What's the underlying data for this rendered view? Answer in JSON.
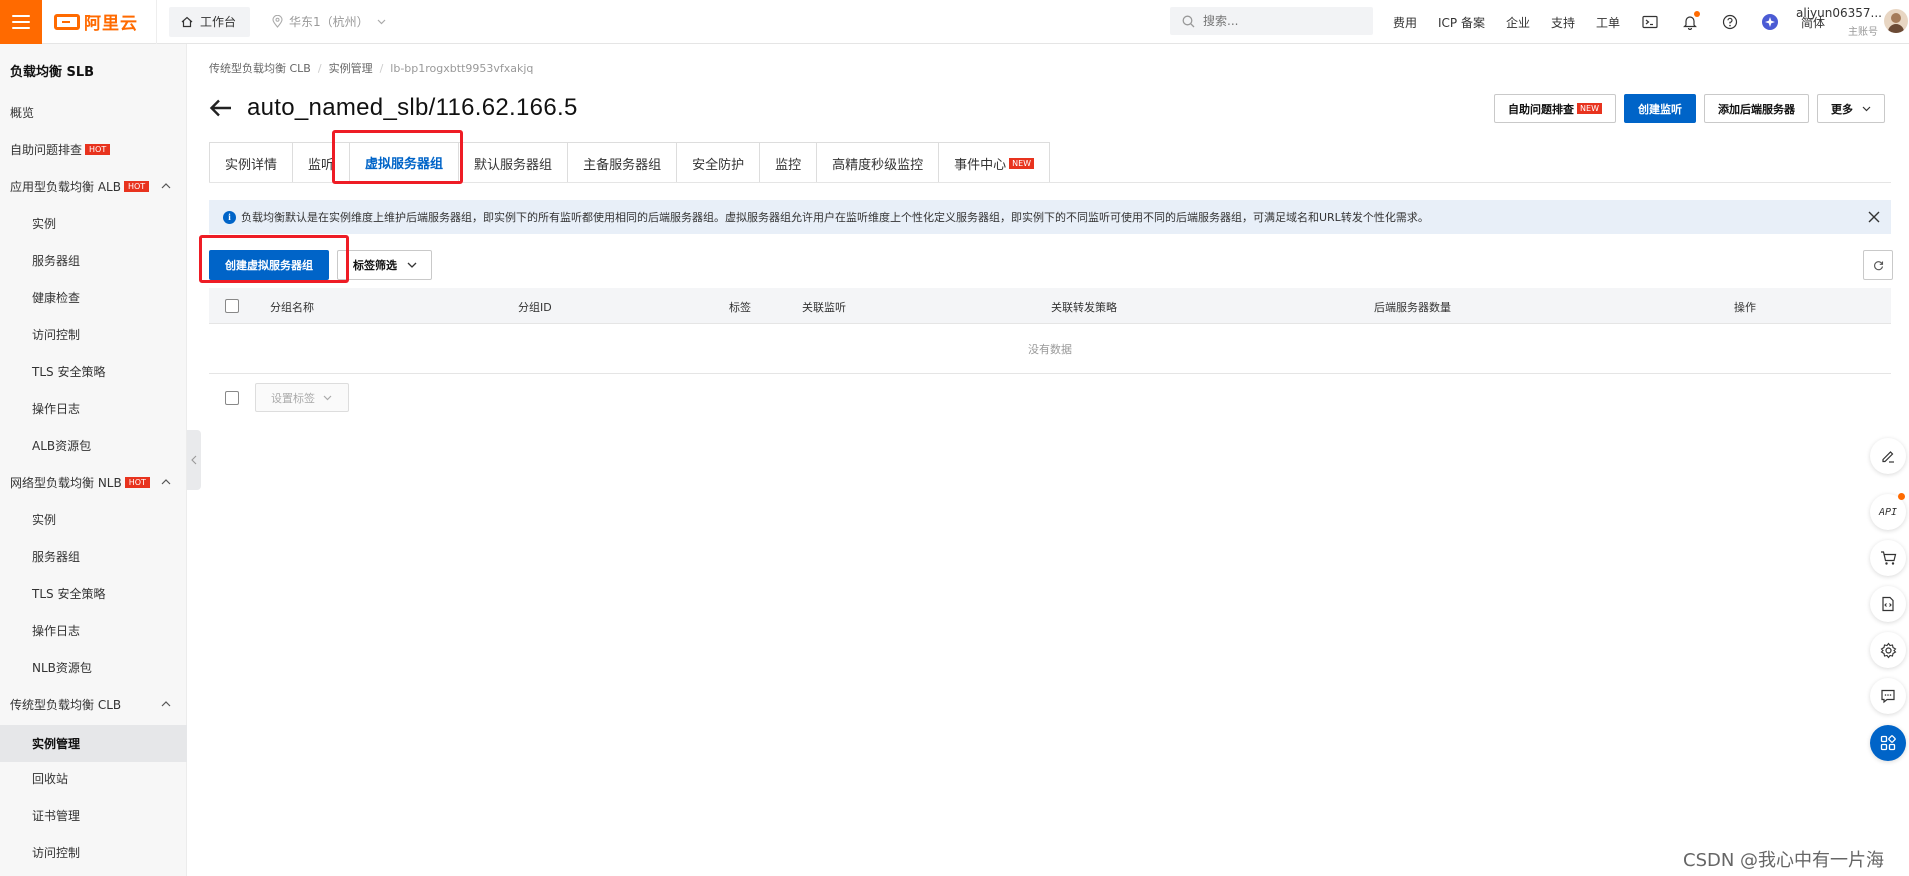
{
  "topbar": {
    "logo_text": "阿里云",
    "workbench_label": "工作台",
    "region_label": "华东1（杭州）",
    "search_placeholder": "搜索...",
    "links": [
      "费用",
      "ICP 备案",
      "企业",
      "支持",
      "工单"
    ],
    "lang_label": "简体",
    "user_name": "aliyun06357...",
    "user_role": "主账号",
    "brand_color": "#ff6a00"
  },
  "sidebar": {
    "title": "负载均衡 SLB",
    "items": [
      {
        "label": "概览",
        "level": 1
      },
      {
        "label": "自助问题排查",
        "level": 1,
        "badge": "HOT"
      },
      {
        "label": "应用型负载均衡 ALB",
        "level": 1,
        "badge": "HOT",
        "expanded": true
      },
      {
        "label": "实例",
        "level": 2
      },
      {
        "label": "服务器组",
        "level": 2
      },
      {
        "label": "健康检查",
        "level": 2
      },
      {
        "label": "访问控制",
        "level": 2
      },
      {
        "label": "TLS 安全策略",
        "level": 2
      },
      {
        "label": "操作日志",
        "level": 2
      },
      {
        "label": "ALB资源包",
        "level": 2
      },
      {
        "label": "网络型负载均衡 NLB",
        "level": 1,
        "badge": "HOT",
        "expanded": true
      },
      {
        "label": "实例",
        "level": 2
      },
      {
        "label": "服务器组",
        "level": 2
      },
      {
        "label": "TLS 安全策略",
        "level": 2
      },
      {
        "label": "操作日志",
        "level": 2
      },
      {
        "label": "NLB资源包",
        "level": 2
      },
      {
        "label": "传统型负载均衡 CLB",
        "level": 1,
        "expanded": true
      },
      {
        "label": "实例管理",
        "level": 2,
        "active": true
      },
      {
        "label": "回收站",
        "level": 2
      },
      {
        "label": "证书管理",
        "level": 2
      },
      {
        "label": "访问控制",
        "level": 2
      }
    ]
  },
  "breadcrumb": [
    "传统型负载均衡 CLB",
    "实例管理",
    "lb-bp1rogxbtt9953vfxakjq"
  ],
  "page": {
    "title": "auto_named_slb/116.62.166.5",
    "buttons": {
      "self_check": "自助问题排查",
      "new_badge": "NEW",
      "create_listener": "创建监听",
      "add_backend": "添加后端服务器",
      "more": "更多"
    },
    "tabs": [
      "实例详情",
      "监听",
      "虚拟服务器组",
      "默认服务器组",
      "主备服务器组",
      "安全防护",
      "监控",
      "高精度秒级监控",
      "事件中心"
    ],
    "active_tab": "虚拟服务器组",
    "event_badge": "NEW",
    "notice": "负载均衡默认是在实例维度上维护后端服务器组，即实例下的所有监听都使用相同的后端服务器组。虚拟服务器组允许用户在监听维度上个性化定义服务器组，即实例下的不同监听可使用不同的后端服务器组，可满足域名和URL转发个性化需求。",
    "create_vgroup_label": "创建虚拟服务器组",
    "tag_filter_label": "标签筛选",
    "table": {
      "columns": [
        "分组名称",
        "分组ID",
        "标签",
        "关联监听",
        "关联转发策略",
        "后端服务器数量",
        "操作"
      ],
      "empty_text": "没有数据"
    },
    "set_tag_label": "设置标签",
    "accent_color": "#0064c8"
  },
  "watermark": "CSDN @我心中有一片海"
}
